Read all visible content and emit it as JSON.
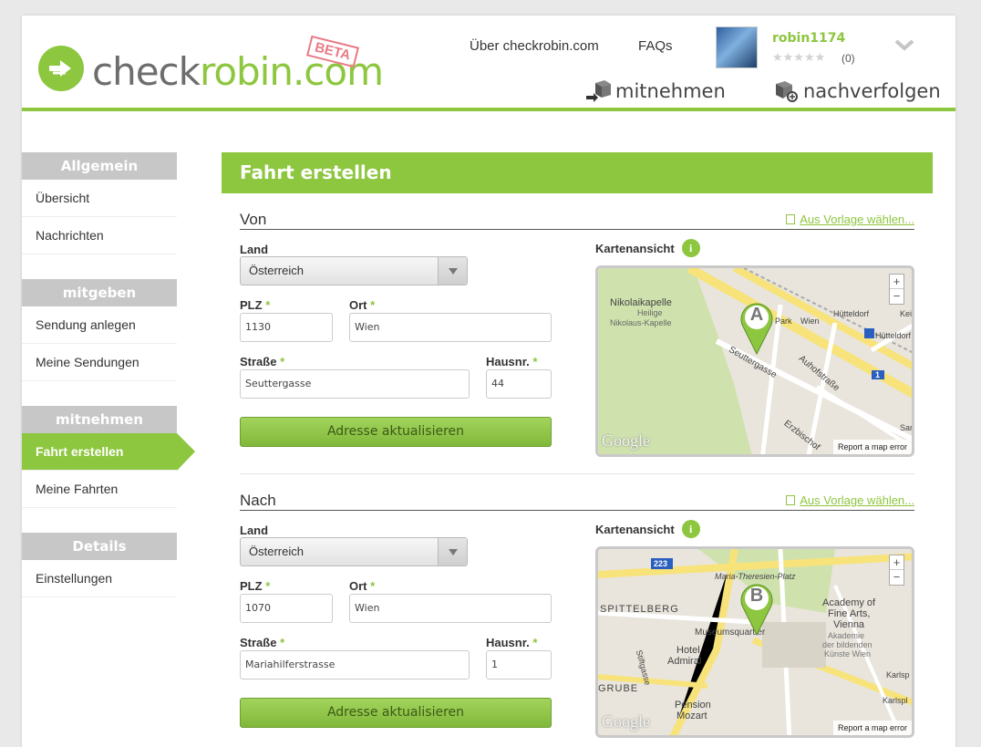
{
  "header": {
    "logo": {
      "part1": "check",
      "part2": "robin.com",
      "badge": "BETA"
    },
    "nav_links": [
      "Über checkrobin.com",
      "FAQs"
    ],
    "user": {
      "name": "robin1174",
      "stars": "★★★★★",
      "rating_count": "(0)"
    },
    "actions": {
      "take": "mitnehmen",
      "track": "nachverfolgen"
    }
  },
  "sidebar": {
    "groups": [
      {
        "title": "Allgemein",
        "items": [
          "Übersicht",
          "Nachrichten"
        ]
      },
      {
        "title": "mitgeben",
        "items": [
          "Sendung anlegen",
          "Meine Sendungen"
        ]
      },
      {
        "title": "mitnehmen",
        "items": [
          "Fahrt erstellen",
          "Meine Fahrten"
        ]
      },
      {
        "title": "Details",
        "items": [
          "Einstellungen"
        ]
      }
    ]
  },
  "main": {
    "title": "Fahrt erstellen",
    "from": {
      "title": "Von",
      "template_link": "Aus Vorlage wählen...",
      "land_label": "Land",
      "land_value": "Österreich",
      "plz_label": "PLZ",
      "plz_value": "1130",
      "ort_label": "Ort",
      "ort_value": "Wien",
      "street_label": "Straße",
      "street_value": "Seuttergasse",
      "house_label": "Hausnr.",
      "house_value": "44",
      "required_mark": "*",
      "button": "Adresse aktualisieren",
      "map_label": "Kartenansicht",
      "map": {
        "marker": "A",
        "places": [
          "Nikolaikapelle",
          "Heilige",
          "Nikolaus-Kapelle",
          "Park",
          "Hütteldorf",
          "Wien",
          "Hütteldorf",
          "Seuttergasse",
          "Auhofstraße",
          "Erzbischof",
          "Keißl",
          "Sar",
          "1"
        ],
        "google": "Google",
        "report": "Report a map error"
      }
    },
    "to": {
      "title": "Nach",
      "template_link": "Aus Vorlage wählen...",
      "land_label": "Land",
      "land_value": "Österreich",
      "plz_label": "PLZ",
      "plz_value": "1070",
      "ort_label": "Ort",
      "ort_value": "Wien",
      "street_label": "Straße",
      "street_value": "Mariahilferstrasse",
      "house_label": "Hausnr.",
      "house_value": "1",
      "required_mark": "*",
      "button": "Adresse aktualisieren",
      "map_label": "Kartenansicht",
      "map": {
        "marker": "B",
        "places": [
          "223",
          "Maria-Theresien-Platz",
          "SPITTELBERG",
          "Museumsquartier",
          "Hotel",
          "Admiral",
          "Academy of",
          "Fine Arts,",
          "Vienna",
          "Akademie",
          "der bildenden",
          "Künste Wien",
          "Karlsp",
          "Karlspl",
          "Stiftgasse",
          "GRUBE",
          "Pension",
          "Mozart"
        ],
        "google": "Google",
        "report": "Report a map error"
      }
    }
  },
  "colors": {
    "accent": "#8dc63f",
    "sidebar_head": "#c7c7c7",
    "beta": "#e87a86"
  },
  "icons": {
    "zoom_in": "+",
    "zoom_out": "−",
    "info": "i"
  }
}
